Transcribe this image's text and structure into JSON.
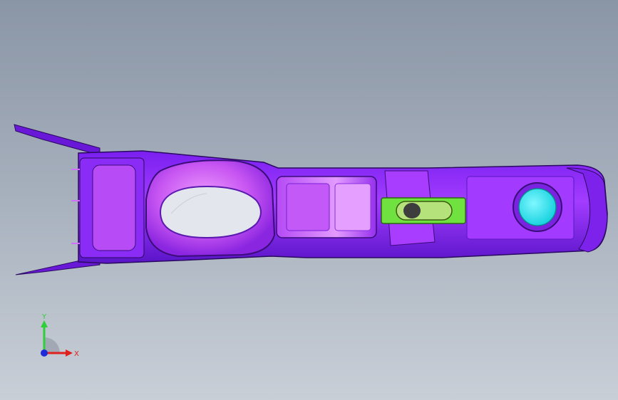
{
  "viewport": {
    "background_top": "#8a95a6",
    "background_bottom": "#c9cfd7"
  },
  "model": {
    "body_color": "#9b2bff",
    "dark_edge_color": "#3a0d7a",
    "highlight_color": "#e08cff",
    "cup_holder_color": "#d86af5",
    "shifter_slot_color": "#6fe23f",
    "button_color": "#2fe7f0"
  },
  "triad": {
    "x_label": "X",
    "y_label": "Y",
    "x_color": "#e0201e",
    "y_color": "#2fcf3a",
    "z_color": "#1f2bd8"
  }
}
